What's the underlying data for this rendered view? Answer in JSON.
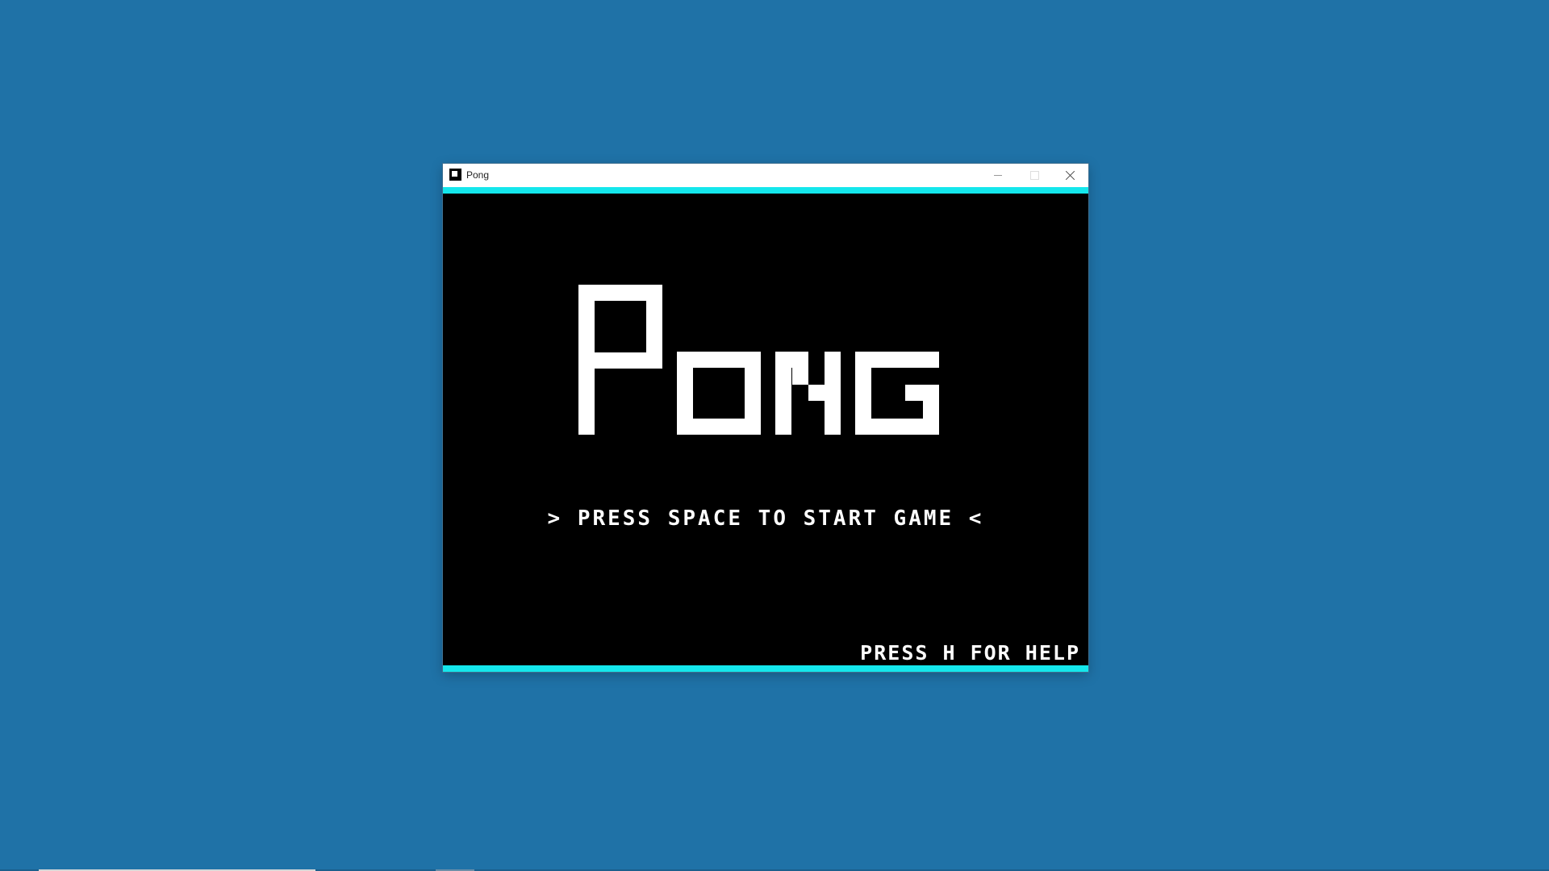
{
  "desktop": {
    "background": "#1f72a7"
  },
  "window": {
    "title": "Pong",
    "app_icon": "app-square-icon",
    "controls": {
      "minimize": "minimize-icon",
      "maximize": "maximize-icon",
      "close": "close-icon"
    },
    "accent_color": "#14e7ec",
    "background": "#000000"
  },
  "game": {
    "logo": "PONG",
    "start_prompt": "> PRESS SPACE TO START GAME <",
    "help_hint": "PRESS H FOR HELP",
    "text_color": "#ffffff"
  }
}
